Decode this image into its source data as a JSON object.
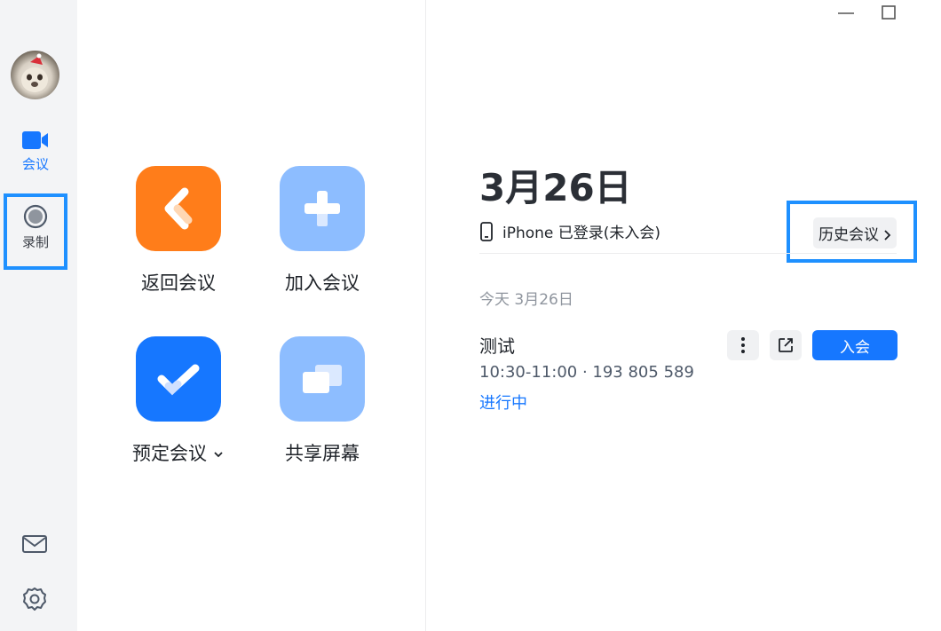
{
  "rail": {
    "items": [
      {
        "label": "会议",
        "icon": "video-camera-icon",
        "active": true
      },
      {
        "label": "录制",
        "icon": "record-icon",
        "active": false
      }
    ],
    "bottom_icons": [
      "mail-icon",
      "gear-icon"
    ]
  },
  "actions": [
    {
      "label": "返回会议",
      "icon": "return-icon",
      "color": "#ff7d1a"
    },
    {
      "label": "加入会议",
      "icon": "plus-icon",
      "color": "#8dbdff"
    },
    {
      "label": "预定会议",
      "icon": "check-icon",
      "color": "#1677ff",
      "has_dropdown": true
    },
    {
      "label": "共享屏幕",
      "icon": "share-screen-icon",
      "color": "#8dbdff"
    }
  ],
  "window_controls": [
    "minimize-icon",
    "maximize-icon"
  ],
  "main": {
    "date": "3月26日",
    "device_status": "iPhone 已登录(未入会)",
    "history_button": "历史会议",
    "section_label": "今天 3月26日",
    "meeting": {
      "title": "测试",
      "time_id": "10:30-11:00 · 193 805 589",
      "status": "进行中",
      "join_label": "入会"
    }
  },
  "colors": {
    "accent": "#1677ff",
    "highlight_border": "#1e90ff",
    "rail_bg": "#f3f4f6"
  }
}
